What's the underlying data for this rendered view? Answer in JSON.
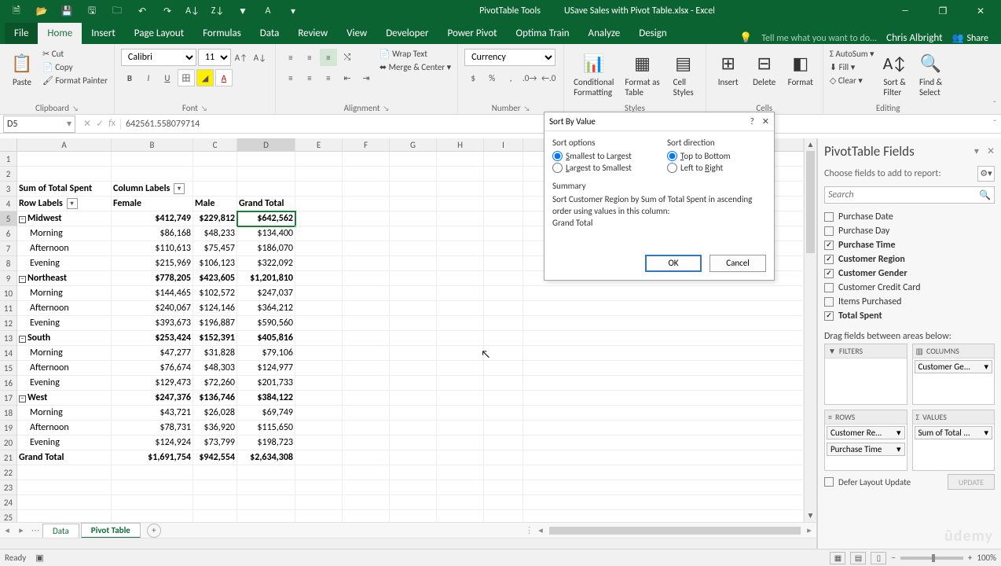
{
  "title": {
    "tools": "PivotTable Tools",
    "file": "USave Sales with Pivot Table.xlsx - Excel"
  },
  "qat": [
    "new",
    "open",
    "save",
    "save-as",
    "folder",
    "undo",
    "redo",
    "sort-az",
    "sort-za",
    "filter",
    "touch",
    "text-box",
    "pivot-wizard",
    "more"
  ],
  "tabs": [
    "File",
    "Home",
    "Insert",
    "Page Layout",
    "Formulas",
    "Data",
    "Review",
    "View",
    "Developer",
    "Power Pivot",
    "Optima Train",
    "Analyze",
    "Design"
  ],
  "tell": "Tell me what you want to do...",
  "user": "Chris Albright",
  "share": "Share",
  "ribbon": {
    "clipboard": {
      "paste": "Paste",
      "cut": "Cut",
      "copy": "Copy",
      "fp": "Format Painter",
      "label": "Clipboard"
    },
    "font": {
      "name": "Calibri",
      "size": "11",
      "label": "Font"
    },
    "align": {
      "wrap": "Wrap Text",
      "merge": "Merge & Center",
      "label": "Alignment"
    },
    "number": {
      "fmt": "Currency",
      "label": "Number"
    },
    "styles": {
      "cf": "Conditional\nFormatting",
      "fat": "Format as\nTable",
      "cs": "Cell\nStyles",
      "label": "Styles"
    },
    "cells": {
      "ins": "Insert",
      "del": "Delete",
      "fmt": "Format",
      "label": "Cells"
    },
    "editing": {
      "sum": "AutoSum",
      "fill": "Fill",
      "clear": "Clear",
      "sort": "Sort &\nFilter",
      "find": "Find &\nSelect",
      "label": "Editing"
    }
  },
  "namebox": "D5",
  "formula": "642561.558079714",
  "cols": [
    "A",
    "B",
    "C",
    "D",
    "E",
    "F",
    "G",
    "H",
    "I"
  ],
  "grid": {
    "a3": "Sum of Total Spent",
    "b3": "Column Labels",
    "a4": "Row Labels",
    "b4": "Female",
    "c4": "Male",
    "d4": "Grand Total",
    "regions": [
      {
        "name": "Midwest",
        "f": "$412,749",
        "m": "$229,812",
        "t": "$642,562",
        "rows": [
          {
            "p": "Morning",
            "f": "$86,168",
            "m": "$48,233",
            "t": "$134,400"
          },
          {
            "p": "Afternoon",
            "f": "$110,613",
            "m": "$75,457",
            "t": "$186,070"
          },
          {
            "p": "Evening",
            "f": "$215,969",
            "m": "$106,123",
            "t": "$322,092"
          }
        ]
      },
      {
        "name": "Northeast",
        "f": "$778,205",
        "m": "$423,605",
        "t": "$1,201,810",
        "rows": [
          {
            "p": "Morning",
            "f": "$144,465",
            "m": "$102,572",
            "t": "$247,037"
          },
          {
            "p": "Afternoon",
            "f": "$240,067",
            "m": "$124,146",
            "t": "$364,212"
          },
          {
            "p": "Evening",
            "f": "$393,673",
            "m": "$196,887",
            "t": "$590,560"
          }
        ]
      },
      {
        "name": "South",
        "f": "$253,424",
        "m": "$152,391",
        "t": "$405,816",
        "rows": [
          {
            "p": "Morning",
            "f": "$47,277",
            "m": "$31,828",
            "t": "$79,106"
          },
          {
            "p": "Afternoon",
            "f": "$76,674",
            "m": "$48,303",
            "t": "$124,977"
          },
          {
            "p": "Evening",
            "f": "$129,473",
            "m": "$72,260",
            "t": "$201,733"
          }
        ]
      },
      {
        "name": "West",
        "f": "$247,376",
        "m": "$136,746",
        "t": "$384,122",
        "rows": [
          {
            "p": "Morning",
            "f": "$43,721",
            "m": "$26,028",
            "t": "$69,749"
          },
          {
            "p": "Afternoon",
            "f": "$78,731",
            "m": "$36,920",
            "t": "$115,650"
          },
          {
            "p": "Evening",
            "f": "$124,924",
            "m": "$73,799",
            "t": "$198,723"
          }
        ]
      }
    ],
    "grand": {
      "label": "Grand Total",
      "f": "$1,691,754",
      "m": "$942,554",
      "t": "$2,634,308"
    }
  },
  "sheets": {
    "s1": "Data",
    "s2": "Pivot Table"
  },
  "dialog": {
    "title": "Sort By Value",
    "sortopts": "Sort options",
    "s2l": "Smallest to Largest",
    "l2s": "Largest to Smallest",
    "dir": "Sort direction",
    "t2b": "Top to Bottom",
    "l2r": "Left to Right",
    "summary": "Summary",
    "sumtext": "Sort Customer Region by Sum of Total Spent in ascending order using values in this column:",
    "sumfield": "Grand Total",
    "ok": "OK",
    "cancel": "Cancel"
  },
  "fields": {
    "title": "PivotTable Fields",
    "sub": "Choose fields to add to report:",
    "search": "Search",
    "list": [
      {
        "n": "Purchase Date",
        "c": false
      },
      {
        "n": "Purchase Day",
        "c": false
      },
      {
        "n": "Purchase Time",
        "c": true
      },
      {
        "n": "Customer Region",
        "c": true
      },
      {
        "n": "Customer Gender",
        "c": true
      },
      {
        "n": "Customer Credit Card",
        "c": false
      },
      {
        "n": "Items Purchased",
        "c": false
      },
      {
        "n": "Total Spent",
        "c": true
      }
    ],
    "drag": "Drag fields between areas below:",
    "filters": "FILTERS",
    "columns": "COLUMNS",
    "rows": "ROWS",
    "values": "VALUES",
    "col1": "Customer Ge...",
    "row1": "Customer Re...",
    "row2": "Purchase Time",
    "val1": "Sum of Total ...",
    "defer": "Defer Layout Update",
    "update": "UPDATE"
  },
  "status": {
    "ready": "Ready",
    "zoom": "100%"
  }
}
